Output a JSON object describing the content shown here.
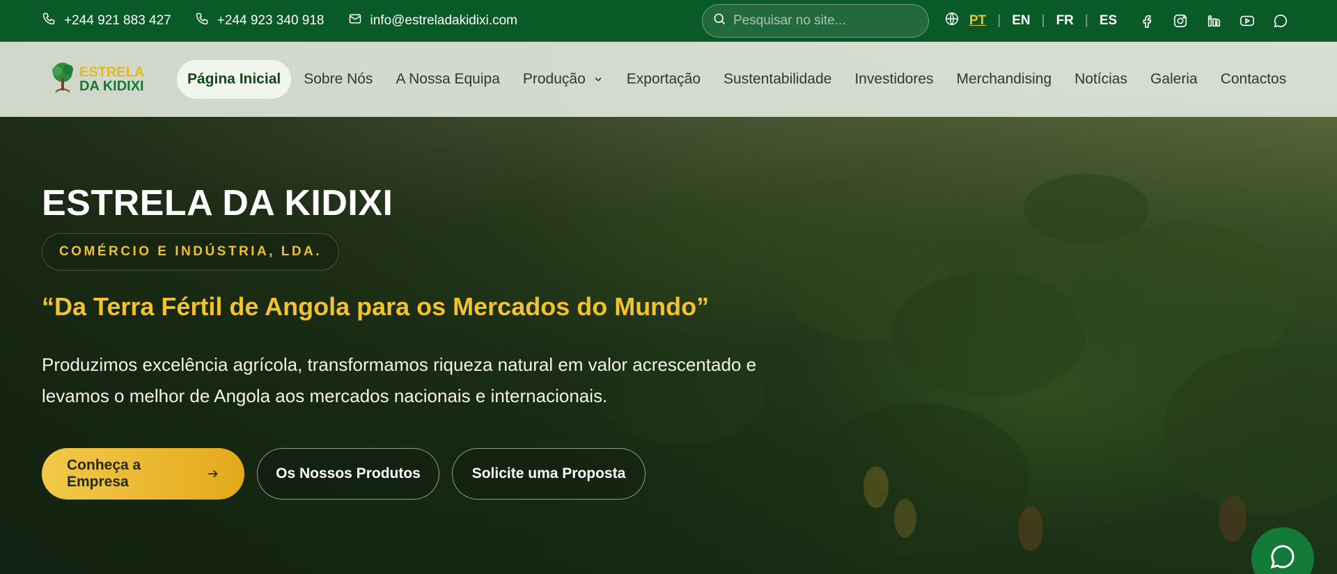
{
  "topbar": {
    "phone1": "+244 921 883 427",
    "phone2": "+244 923 340 918",
    "email": "info@estreladakidixi.com",
    "search_placeholder": "Pesquisar no site...",
    "languages": [
      "PT",
      "EN",
      "FR",
      "ES"
    ],
    "active_language": "PT",
    "socials": [
      "facebook-icon",
      "instagram-icon",
      "linkedin-icon",
      "youtube-icon",
      "chat-icon"
    ]
  },
  "logo": {
    "line1": "ESTRELA",
    "line2": "DA KIDIXI"
  },
  "nav": {
    "items": [
      "Página Inicial",
      "Sobre Nós",
      "A Nossa Equipa",
      "Produção",
      "Exportação",
      "Sustentabilidade",
      "Investidores",
      "Merchandising",
      "Notícias",
      "Galeria",
      "Contactos"
    ],
    "active": "Página Inicial"
  },
  "hero": {
    "title": "ESTRELA DA KIDIXI",
    "badge": "COMÉRCIO E INDÚSTRIA, LDA.",
    "tagline": "“Da Terra Fértil de Angola para os Mercados do Mundo”",
    "description": "Produzimos excelência agrícola, transformamos riqueza natural em valor acrescentado e levamos o melhor de Angola aos mercados nacionais e internacionais.",
    "buttons": {
      "primary": "Conheça a Empresa",
      "secondary": "Os Nossos Produtos",
      "tertiary": "Solicite uma Proposta"
    }
  },
  "colors": {
    "topbar": "#0a5a28",
    "accent": "#f2c230",
    "nav_bg": "#e1e6da",
    "fab": "#147a3a"
  }
}
